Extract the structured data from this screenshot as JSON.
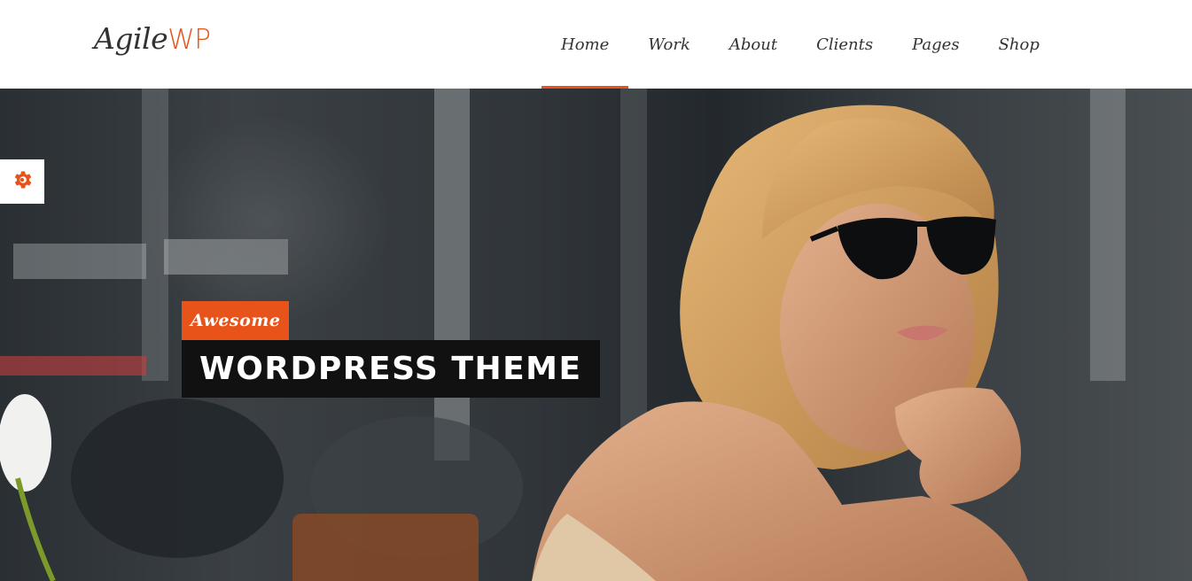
{
  "brand": {
    "logo_part1": "Agile",
    "logo_part2": "WP"
  },
  "nav": {
    "items": [
      {
        "label": "Home",
        "active": true
      },
      {
        "label": "Work"
      },
      {
        "label": "About"
      },
      {
        "label": "Clients"
      },
      {
        "label": "Pages"
      },
      {
        "label": "Shop"
      }
    ]
  },
  "hero": {
    "tagline": "Awesome",
    "headline": "WORDPRESS THEME"
  },
  "settings": {
    "icon": "gear-icon"
  },
  "colors": {
    "accent": "#e8531a",
    "header_bg": "#ffffff",
    "headline_bg": "#111111"
  }
}
